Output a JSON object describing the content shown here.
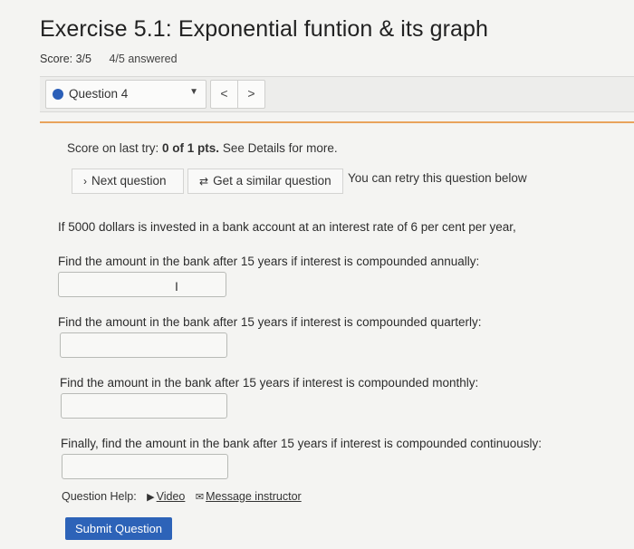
{
  "header": {
    "title": "Exercise 5.1: Exponential funtion & its graph",
    "score": "Score: 3/5",
    "answered": "4/5 answered"
  },
  "question_nav": {
    "selected": "Question 4",
    "prev_label": "<",
    "next_label": ">",
    "accent": "#2b5fb8"
  },
  "status": {
    "prefix": "Score on last try: ",
    "score_bold": "0 of 1 pts.",
    "suffix": " See Details for more."
  },
  "actions": {
    "next_question": "Next question",
    "similar_question": "Get a similar question",
    "retry_note": "You can retry this question below"
  },
  "question": {
    "intro": "If 5000 dollars is invested in a bank account at an interest rate of 6 per cent per year,",
    "parts": [
      {
        "prompt": "Find the amount in the bank after 15 years if interest is compounded annually:",
        "value": ""
      },
      {
        "prompt": "Find the amount in the bank after 15 years if interest is compounded quarterly:",
        "value": ""
      },
      {
        "prompt": "Find the amount in the bank after 15 years if interest is compounded monthly:",
        "value": ""
      },
      {
        "prompt": "Finally, find the amount in the bank after 15 years if interest is compounded continuously:",
        "value": ""
      }
    ]
  },
  "help": {
    "label": "Question Help:",
    "video": "Video",
    "message": "Message instructor"
  },
  "submit_label": "Submit Question",
  "colors": {
    "divider": "#e8a35c",
    "submit_bg": "#2d63b8"
  }
}
